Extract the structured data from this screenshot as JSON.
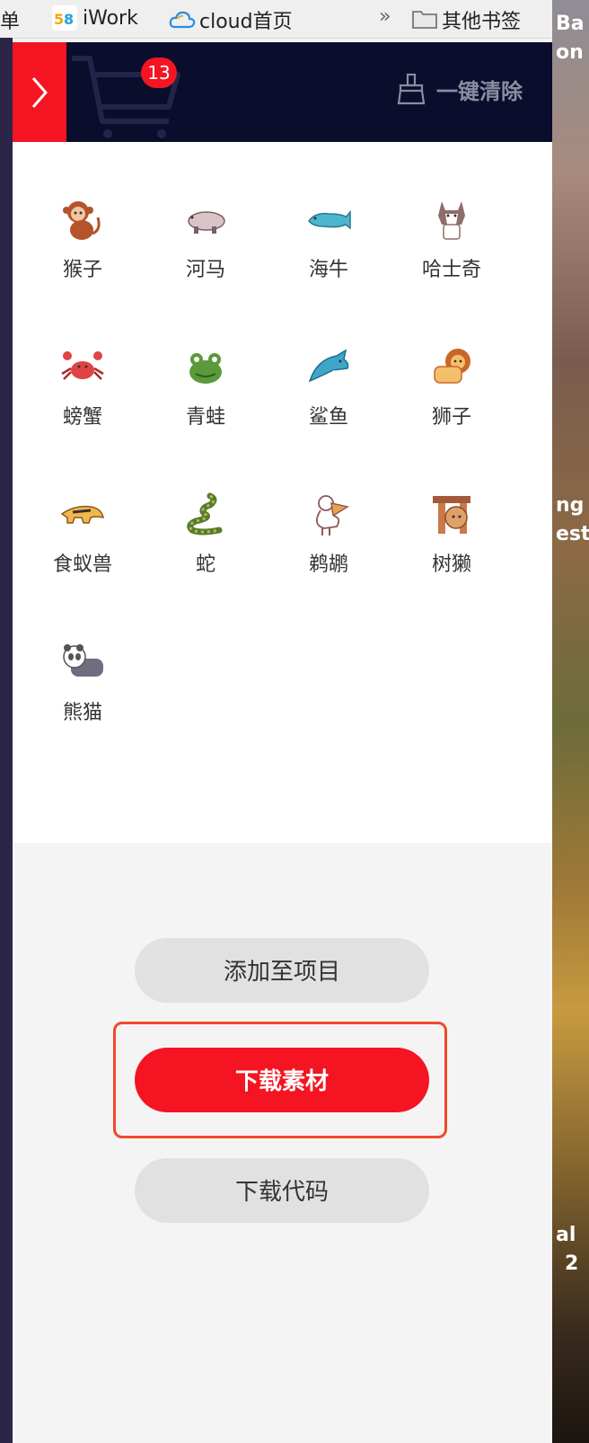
{
  "bookmarks": {
    "items": [
      {
        "label": "菜单",
        "icon": "list-icon"
      },
      {
        "label": "iWork",
        "icon": "58-logo-icon"
      },
      {
        "label": "cloud首页",
        "icon": "cloud-icon"
      },
      {
        "label": "»",
        "icon": ""
      },
      {
        "label": "其他书签",
        "icon": "folder-icon"
      }
    ]
  },
  "desktop": {
    "texts": [
      "Ba",
      "on",
      "ng",
      "est",
      "al",
      "2"
    ]
  },
  "cart": {
    "count": "13",
    "clear_label": "一键清除"
  },
  "icons": [
    {
      "label": "猴子",
      "icon": "monkey-icon"
    },
    {
      "label": "河马",
      "icon": "hippo-icon"
    },
    {
      "label": "海牛",
      "icon": "manatee-icon"
    },
    {
      "label": "哈士奇",
      "icon": "husky-icon"
    },
    {
      "label": "螃蟹",
      "icon": "crab-icon"
    },
    {
      "label": "青蛙",
      "icon": "frog-icon"
    },
    {
      "label": "鲨鱼",
      "icon": "shark-icon"
    },
    {
      "label": "狮子",
      "icon": "lion-icon"
    },
    {
      "label": "食蚁兽",
      "icon": "anteater-icon"
    },
    {
      "label": "蛇",
      "icon": "snake-icon"
    },
    {
      "label": "鹈鹕",
      "icon": "pelican-icon"
    },
    {
      "label": "树獭",
      "icon": "sloth-icon"
    },
    {
      "label": "熊猫",
      "icon": "panda-icon"
    }
  ],
  "actions": {
    "add_label": "添加至项目",
    "download_assets_label": "下载素材",
    "download_code_label": "下载代码"
  },
  "colors": {
    "accent": "#f51421",
    "header_bg": "#0b0d2d",
    "highlight": "#ef4a2a"
  }
}
